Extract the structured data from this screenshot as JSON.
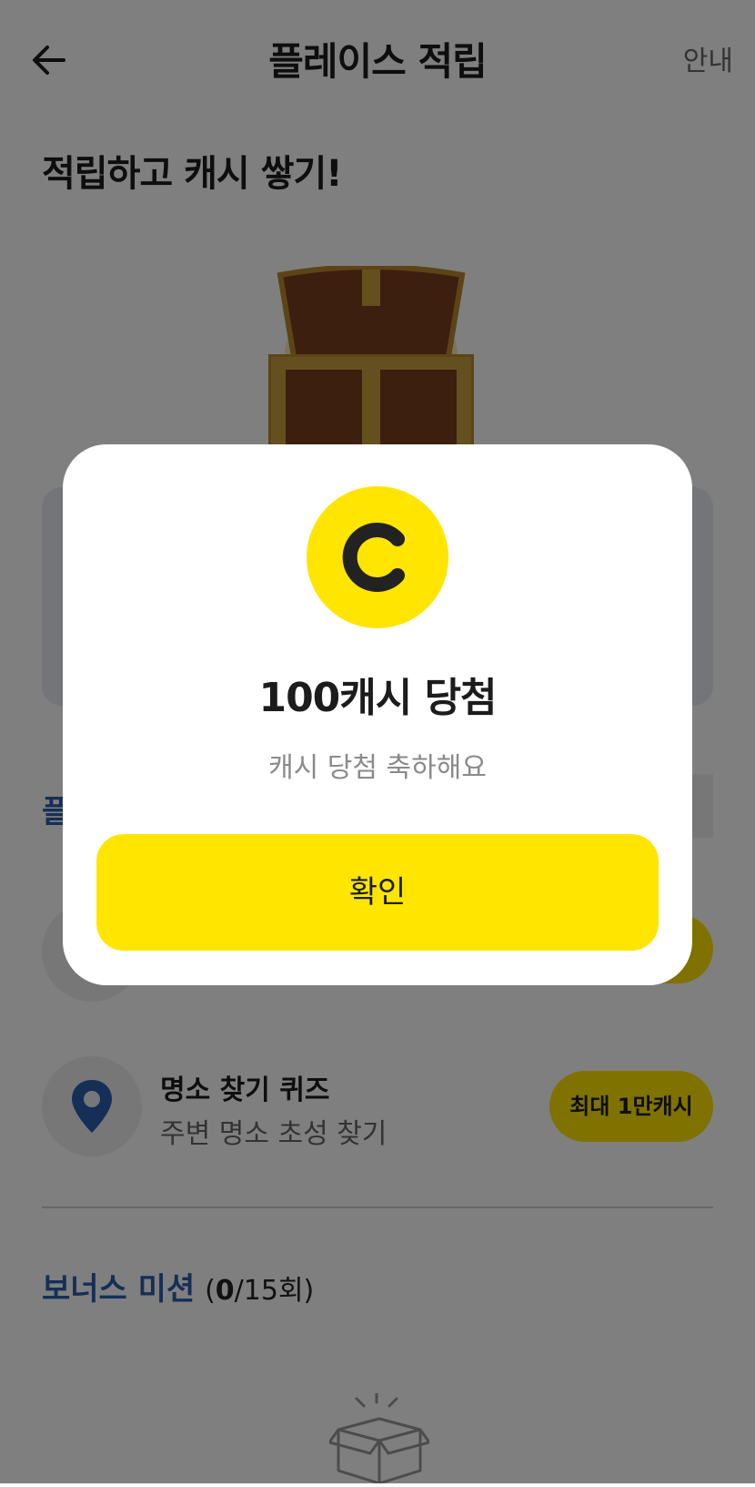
{
  "header": {
    "title": "플레이스 적립",
    "guide_label": "안내"
  },
  "headline": "적립하고 캐시 쌓기!",
  "section_peek": "플",
  "quiz": {
    "title": "명소 찾기 퀴즈",
    "subtitle": "주변 명소 초성 찾기",
    "reward": "최대 1만캐시"
  },
  "bonus": {
    "label": "보너스 미션",
    "count_open": "(",
    "count_current": "0",
    "count_total": "/15회)"
  },
  "modal": {
    "title": "100캐시 당첨",
    "subtitle": "캐시 당첨 축하해요",
    "confirm_label": "확인"
  },
  "colors": {
    "accent_yellow": "#ffe500",
    "accent_blue": "#2b5fae",
    "overlay": "rgba(0,0,0,0.5)"
  },
  "icons": [
    "back-arrow-icon",
    "treasure-chest-icon",
    "map-pin-icon",
    "open-box-icon",
    "cash-coin-icon"
  ]
}
